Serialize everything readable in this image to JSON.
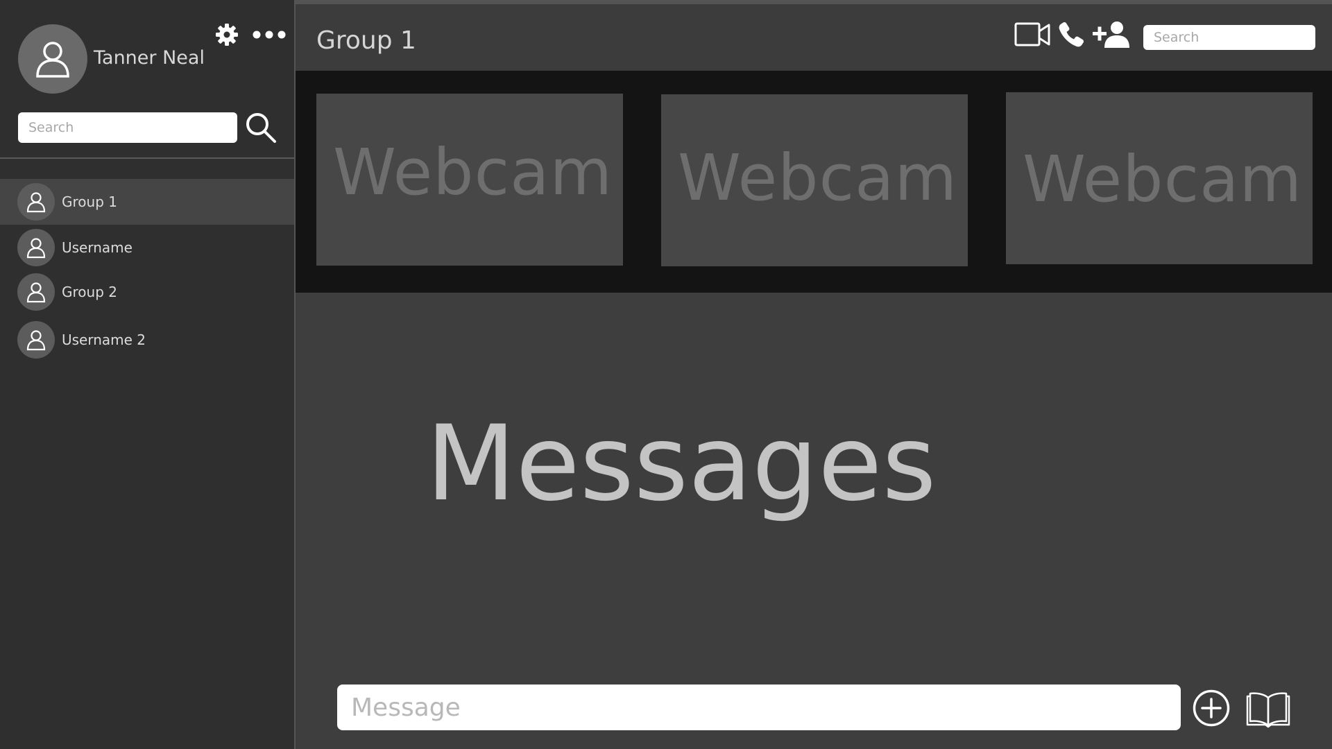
{
  "user": {
    "name": "Tanner Neal"
  },
  "sidebar": {
    "search_placeholder": "Search",
    "items": [
      {
        "label": "Group 1",
        "active": true
      },
      {
        "label": "Username",
        "active": false
      },
      {
        "label": "Group 2",
        "active": false
      },
      {
        "label": "Username 2",
        "active": false
      }
    ]
  },
  "header": {
    "title": "Group 1",
    "search_placeholder": "Search"
  },
  "webcams": [
    {
      "label": "Webcam"
    },
    {
      "label": "Webcam"
    },
    {
      "label": "Webcam"
    }
  ],
  "messages": {
    "label": "Messages"
  },
  "composer": {
    "placeholder": "Message"
  },
  "icons": {
    "settings": "gear-icon",
    "more": "more-horizontal-icon",
    "search": "search-icon",
    "video_call": "video-camera-icon",
    "voice_call": "phone-icon",
    "add_user": "add-user-icon",
    "add": "plus-circle-icon",
    "library": "open-book-icon"
  },
  "colors": {
    "sidebar_bg": "#2f2f2f",
    "main_bg": "#3e3e3e",
    "webcam_strip_bg": "#141414",
    "webcam_tile_bg": "#474747",
    "active_item_bg": "#454545"
  }
}
